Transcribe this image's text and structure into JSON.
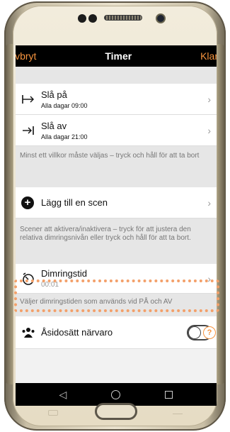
{
  "navbar": {
    "cancel": "Avbryt",
    "title": "Timer",
    "done": "Klar"
  },
  "rows": {
    "on": {
      "title": "Slå på",
      "sub": "Alla dagar 09:00"
    },
    "off": {
      "title": "Slå av",
      "sub": "Alla dagar 21:00"
    }
  },
  "notes": {
    "condition": "Minst ett villkor måste väljas – tryck och håll för att ta bort",
    "scene": "Scener att aktivera/inaktivera – tryck för att justera den relativa dimringsnivån eller tryck och håll för att ta bort.",
    "dimming": "Väljer dimringstiden som används vid PÅ och AV"
  },
  "scene": {
    "label": "Lägg till en scen"
  },
  "dimming": {
    "title": "Dimringstid",
    "value": "00:01"
  },
  "presence": {
    "label": "Åsidosätt närvaro",
    "toggle_on": false,
    "help": "?"
  },
  "icons": {
    "on": "arrow-to-bar-icon",
    "off": "arrow-right-bar-icon",
    "add": "plus-circle-icon",
    "timer": "stopwatch-icon",
    "presence": "people-icon",
    "back": "back-triangle-icon",
    "home": "home-circle-icon",
    "recents": "recents-square-icon"
  },
  "colors": {
    "accent": "#f7943e",
    "highlight": "#f3a06a"
  }
}
